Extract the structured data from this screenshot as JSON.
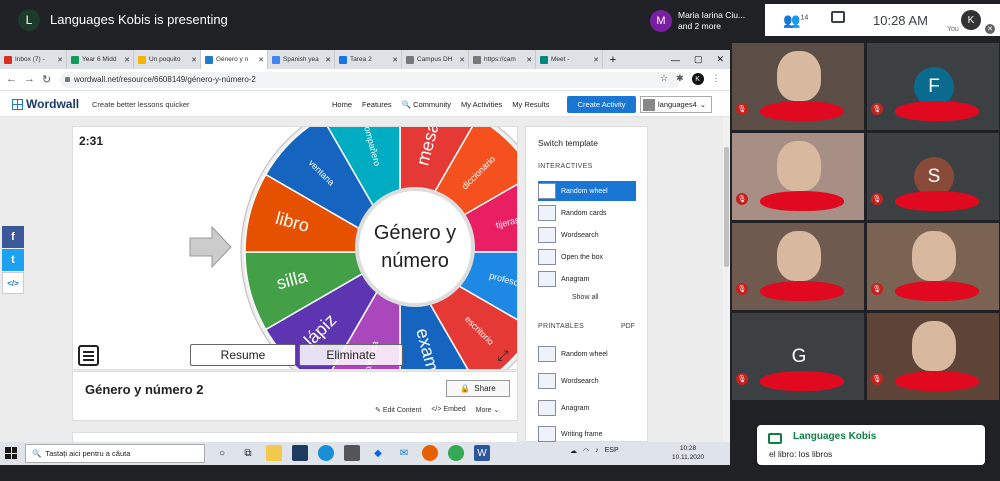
{
  "meet": {
    "presenter_initial": "L",
    "presenting_text": "Languages Kobis is presenting",
    "people_card": {
      "initial": "M",
      "line1": "Maria Iarina Ciu...",
      "line2": "and 2 more"
    },
    "people_count": "14",
    "time": "10:28 AM",
    "self_initial": "K",
    "self_label": "You"
  },
  "browser": {
    "tabs": [
      {
        "label": "Inbox (7) -",
        "color": "#d93025"
      },
      {
        "label": "Year 6 Midd",
        "color": "#0f9d58"
      },
      {
        "label": "Un poquito",
        "color": "#f4b400"
      },
      {
        "label": "Género y n",
        "color": "#1f7bc9",
        "active": true
      },
      {
        "label": "Spanish yea",
        "color": "#4285f4"
      },
      {
        "label": "Tarea 2",
        "color": "#1a73e8"
      },
      {
        "label": "Campus DH",
        "color": "#777777"
      },
      {
        "label": "https://cam",
        "color": "#777777"
      },
      {
        "label": "Meet -",
        "color": "#00897b"
      }
    ],
    "new_tab": "+",
    "window_controls": [
      "—",
      "▢",
      "✕"
    ],
    "url": "wordwall.net/resource/6608149/género-y-número-2"
  },
  "wordwall": {
    "logo": "Wordwall",
    "tagline": "Create better lessons quicker",
    "nav": [
      "Home",
      "Features",
      "Community",
      "My Activities",
      "My Results"
    ],
    "create_button": "Create Activity",
    "user": "languages4",
    "timer": "2:31",
    "wheel_center_line1": "Género y",
    "wheel_center_line2": "número",
    "wheel_segments": [
      {
        "label": "mesa",
        "color": "#e53935"
      },
      {
        "label": "diccionario",
        "color": "#f4511e"
      },
      {
        "label": "tijeras",
        "color": "#e91e63"
      },
      {
        "label": "profesora",
        "color": "#1e88e5"
      },
      {
        "label": "escritorio",
        "color": "#e53935"
      },
      {
        "label": "examen",
        "color": "#1565c0"
      },
      {
        "label": "biblioteca",
        "color": "#ab47bc"
      },
      {
        "label": "lápiz",
        "color": "#5e35b1"
      },
      {
        "label": "silla",
        "color": "#43a047"
      },
      {
        "label": "libro",
        "color": "#e65100"
      },
      {
        "label": "ventana",
        "color": "#1565c0"
      },
      {
        "label": "compañero",
        "color": "#00acc1"
      }
    ],
    "resume_button": "Resume",
    "eliminate_button": "Eliminate",
    "activity_title": "Género y número 2",
    "share_button": "Share",
    "links": [
      "Edit Content",
      "Embed",
      "More"
    ],
    "side_panel": {
      "heading": "Switch template",
      "interactives_label": "INTERACTIVES",
      "interactives": [
        "Random wheel",
        "Random cards",
        "Wordsearch",
        "Open the box",
        "Anagram"
      ],
      "show_all": "Show all",
      "printables_label": "PRINTABLES",
      "pdf_label": "PDF",
      "printables": [
        "Random wheel",
        "Wordsearch",
        "Anagram",
        "Writing frame"
      ]
    }
  },
  "taskbar": {
    "search_placeholder": "Tastați aici pentru a căuta",
    "lang": "ESP",
    "time": "10:28",
    "date": "10.11.2020"
  },
  "participants": [
    {
      "type": "video",
      "bg": "#5a4e47"
    },
    {
      "type": "avatar",
      "initial": "F",
      "bg": "#0b6b8f"
    },
    {
      "type": "video",
      "bg": "#a88f86"
    },
    {
      "type": "avatar",
      "initial": "S",
      "bg": "#8a4a3a"
    },
    {
      "type": "video",
      "bg": "#6e5a4e"
    },
    {
      "type": "video",
      "bg": "#7a6352"
    },
    {
      "type": "avatar",
      "initial": "G",
      "bg": "#3c4043"
    },
    {
      "type": "video",
      "bg": "#5d4437"
    }
  ],
  "chat_notification": {
    "sender": "Languages Kobis",
    "message": "el libro: los libros"
  }
}
